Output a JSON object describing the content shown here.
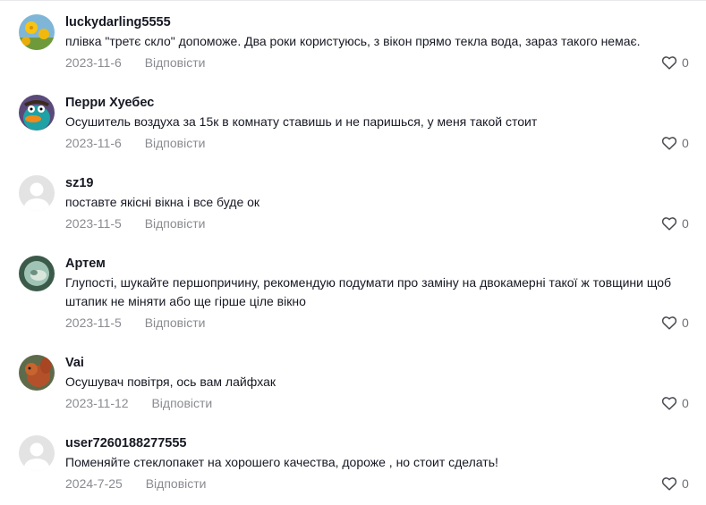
{
  "comments": [
    {
      "username": "luckydarling5555",
      "text": "плівка \"третє скло\" допоможе. Два роки користуюсь, з вікон прямо текла вода, зараз такого немає.",
      "date": "2023-11-6",
      "reply": "Відповісти",
      "likes": "0",
      "avatar": "dandelion-avatar"
    },
    {
      "username": "Перри Хуебес",
      "text": "Осушитель воздуха за 15к в комнату ставишь и не паришься, у меня такой стоит",
      "date": "2023-11-6",
      "reply": "Відповісти",
      "likes": "0",
      "avatar": "platypus-avatar"
    },
    {
      "username": "sz19",
      "text": "поставте якісні вікна і все буде ок",
      "date": "2023-11-5",
      "reply": "Відповісти",
      "likes": "0",
      "avatar": "default-avatar"
    },
    {
      "username": "Артем",
      "text": "Глупості, шукайте першопричину, рекомендую подумати про заміну на двокамерні такої ж товщини щоб штапик не міняти або ще гірше ціле вікно",
      "date": "2023-11-5",
      "reply": "Відповісти",
      "likes": "0",
      "avatar": "photo-avatar"
    },
    {
      "username": "Vai",
      "text": "Осушувач повітря, ось вам лайфхак",
      "date": "2023-11-12",
      "reply": "Відповісти",
      "likes": "0",
      "avatar": "squirrel-avatar"
    },
    {
      "username": "user7260188277555",
      "text": "Поменяйте стеклопакет на хорошего качества, дороже , но стоит сделать!",
      "date": "2024-7-25",
      "reply": "Відповісти",
      "likes": "0",
      "avatar": "default-avatar"
    }
  ]
}
